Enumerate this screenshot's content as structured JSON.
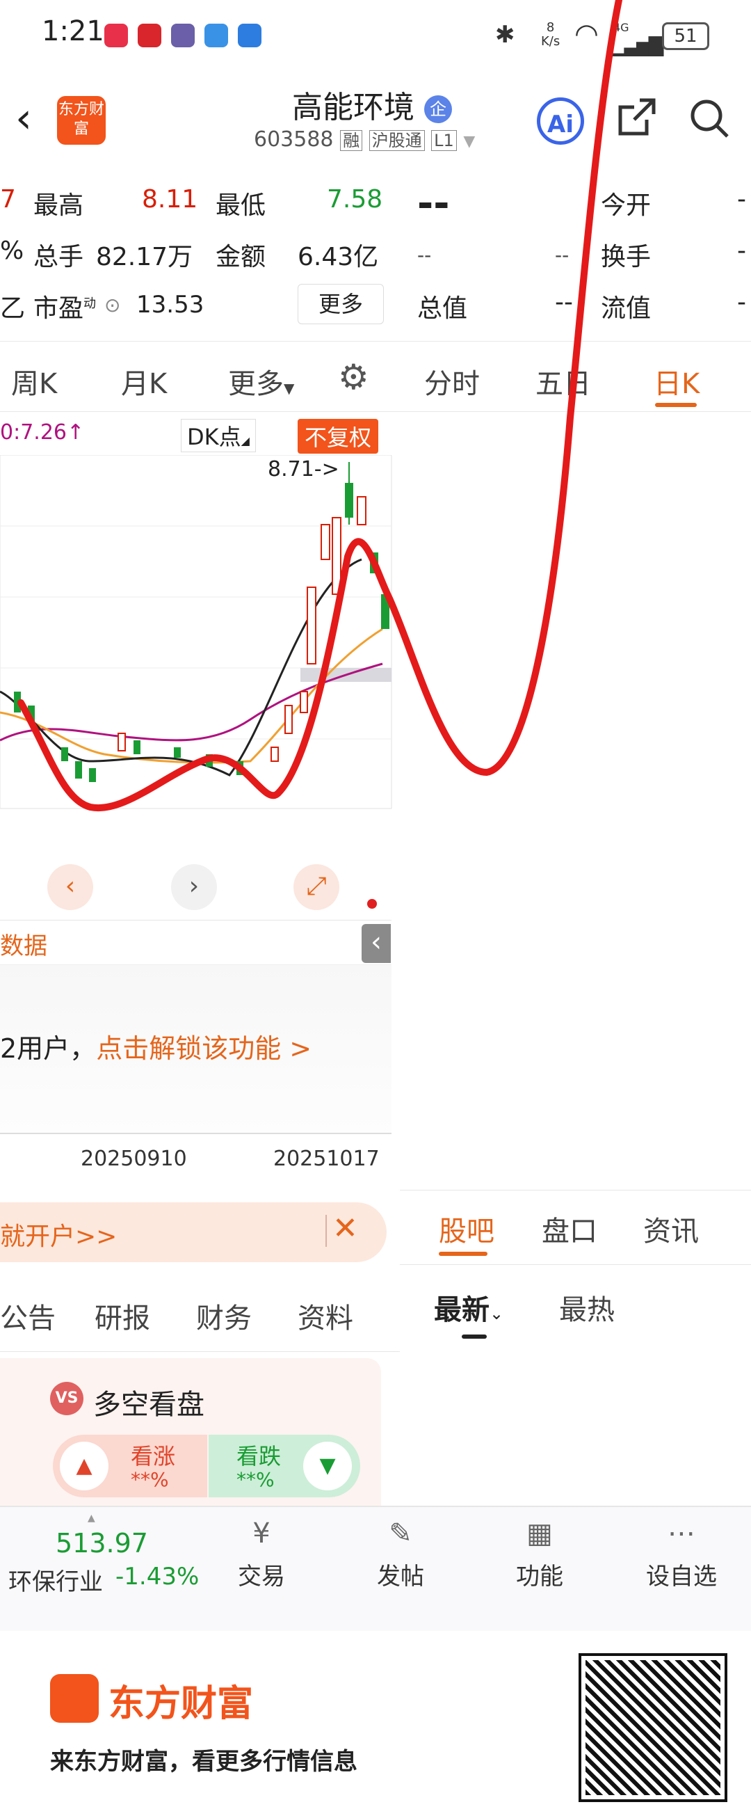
{
  "status_bar": {
    "time": "1:21",
    "network_speed_value": "8",
    "network_speed_unit": "K/s",
    "signal_type": "4G",
    "battery": "51"
  },
  "header": {
    "logo_text": "东方财富",
    "title": "高能环境",
    "title_badge": "企",
    "code": "603588",
    "tag_margin": "融",
    "tag_connect": "沪股通",
    "tag_level": "L1",
    "ai_label": "Ai"
  },
  "quote": {
    "partial_left_1": "7",
    "partial_left_2": "%",
    "partial_left_3": "乙",
    "high_label": "最高",
    "high_value": "8.11",
    "low_label": "最低",
    "low_value": "7.58",
    "volume_label": "总手",
    "volume_value": "82.17万",
    "amount_label": "金额",
    "amount_value": "6.43亿",
    "pe_label": "市盈",
    "pe_sup": "动",
    "pe_value": "13.53",
    "more_button": "更多",
    "price_dash": "--",
    "small_dash_1": "--",
    "small_dash_2": "--",
    "total_value_label": "总值",
    "total_value": "--",
    "open_label": "今开",
    "open_value": "-",
    "turnover_label": "换手",
    "turnover_value": "-",
    "float_value_label": "流值",
    "float_value": "-"
  },
  "tabs": [
    {
      "label": "周K"
    },
    {
      "label": "月K"
    },
    {
      "label": "更多"
    },
    {
      "label": "分时"
    },
    {
      "label": "五日"
    },
    {
      "label": "日K"
    }
  ],
  "chart": {
    "ma_text": "0:7.26↑",
    "dk_label": "DK点",
    "fq_label": "不复权",
    "high_marker": "8.71->",
    "date_left": "20250910",
    "date_right": "20251017",
    "data_tab": "数据",
    "unlock_prefix": "2用户，",
    "unlock_link": "点击解锁该功能 >"
  },
  "promo": {
    "text": "就开户>>"
  },
  "left_tabs": [
    "公告",
    "研报",
    "财务",
    "资料"
  ],
  "right_tabs": [
    "股吧",
    "盘口",
    "资讯"
  ],
  "sort_tabs": {
    "newest": "最新",
    "hottest": "最热"
  },
  "vs_card": {
    "title": "多空看盘",
    "vs": "VS",
    "up_label": "看涨",
    "up_value": "**%",
    "down_label": "看跌",
    "down_value": "**%"
  },
  "bottom_nav": {
    "industry_value": "513.97",
    "industry_name": "环保行业",
    "industry_change": "-1.43%",
    "trade": "交易",
    "post": "发帖",
    "features": "功能",
    "watchlist": "设自选"
  },
  "footer": {
    "brand": "东方财富",
    "slogan": "来东方财富，看更多行情信息"
  }
}
